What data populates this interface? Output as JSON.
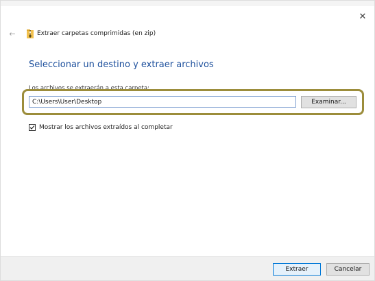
{
  "window": {
    "title": "Extraer carpetas comprimidas (en zip)",
    "close_glyph": "✕",
    "back_glyph": "←"
  },
  "main": {
    "heading": "Seleccionar un destino y extraer archivos",
    "destination_label": "Los archivos se extraerán a esta carpeta:",
    "destination_path": "C:\\Users\\User\\Desktop",
    "browse_label": "Examinar...",
    "show_files_checked": true,
    "show_files_label": "Mostrar los archivos extraídos al completar",
    "check_glyph": "✓"
  },
  "footer": {
    "extract_label": "Extraer",
    "cancel_label": "Cancelar"
  },
  "colors": {
    "heading": "#1c4f9c",
    "highlight_ring": "#9c8d3b",
    "primary_button_border": "#0078d7",
    "zip_folder": "#f2c14e"
  },
  "icons": {
    "back": "back-arrow-icon",
    "close": "close-icon",
    "zip": "zip-folder-icon",
    "check": "checkmark-icon"
  }
}
